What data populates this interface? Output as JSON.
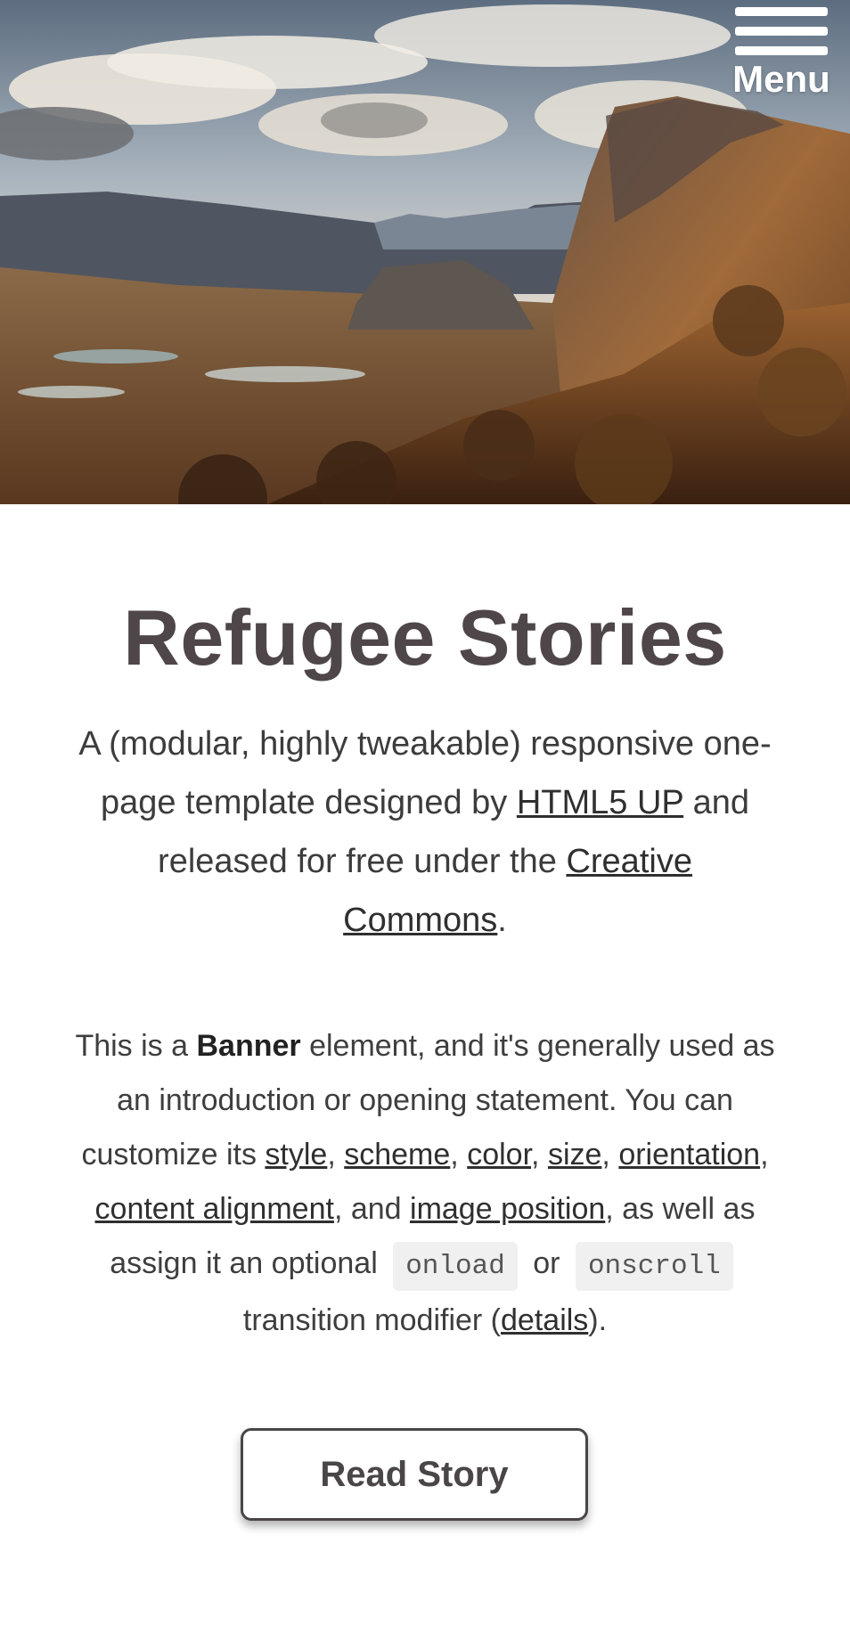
{
  "header": {
    "menu_label": "Menu"
  },
  "banner": {
    "title": "Refugee Stories",
    "intro": {
      "part1": "A (modular, highly tweakable) responsive one-page template designed by ",
      "link_html5up": "HTML5 UP",
      "part2": " and released for free under the ",
      "link_cc": "Creative Commons",
      "part3": "."
    },
    "body": {
      "p1": "This is a ",
      "bold_banner": "Banner",
      "p2": " element, and it's generally used as an introduction or opening statement. You can customize its ",
      "link_style": "style",
      "sep1": ", ",
      "link_scheme": "scheme",
      "sep2": ", ",
      "link_color": "color",
      "sep3": ", ",
      "link_size": "size",
      "sep4": ", ",
      "link_orientation": "orientation",
      "sep5": ", ",
      "link_alignment": "content alignment",
      "p3": ", and ",
      "link_image_position": "image position",
      "p4": ", as well as assign it an optional ",
      "code_onload": "onload",
      "p5": " or ",
      "code_onscroll": "onscroll",
      "p6": " transition modifier (",
      "link_details": "details",
      "p7": ")."
    },
    "cta_label": "Read Story"
  },
  "icons": {
    "menu": "hamburger-icon"
  },
  "colors": {
    "title": "#4e4648",
    "button_border": "#4a4547",
    "code_bg": "#f0f0f0"
  }
}
